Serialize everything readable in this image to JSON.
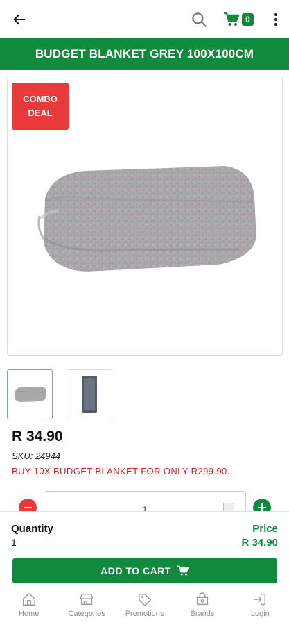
{
  "header": {
    "back_icon": "arrow-left-icon",
    "search_icon": "search-icon",
    "cart_icon": "cart-icon",
    "cart_count": "0",
    "menu_icon": "more-vertical-icon"
  },
  "product": {
    "title": "BUDGET BLANKET GREY 100X100CM",
    "badge": "COMBO\nDEAL",
    "price": "R 34.90",
    "sku": "SKU: 24944",
    "promo": "BUY 10X BUDGET BLANKET FOR ONLY R299.90."
  },
  "quantity_input": {
    "value": "1"
  },
  "summary": {
    "quantity_label": "Quantity",
    "quantity_value": "1",
    "price_label": "Price",
    "price_value": "R 34.90",
    "add_to_cart_label": "ADD TO CART"
  },
  "tabs": [
    {
      "label": "Home",
      "icon": "home-icon"
    },
    {
      "label": "Categories",
      "icon": "store-icon"
    },
    {
      "label": "Promotions",
      "icon": "tag-icon"
    },
    {
      "label": "Brands",
      "icon": "brands-icon"
    },
    {
      "label": "Login",
      "icon": "login-icon"
    }
  ],
  "colors": {
    "brand_green": "#128a3e",
    "badge_red": "#e83a3a",
    "promo_red": "#e11d1d"
  }
}
